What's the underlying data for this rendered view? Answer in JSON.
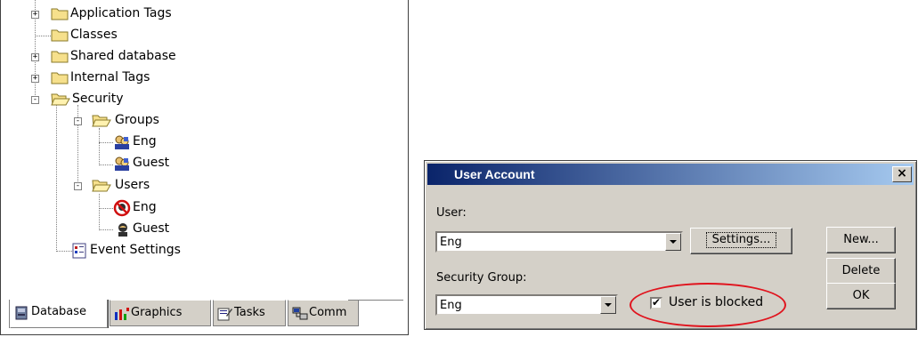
{
  "tree": {
    "nodes": [
      {
        "label": "Application Tags",
        "icon": "folder-icon",
        "expander": "+"
      },
      {
        "label": "Classes",
        "icon": "folder-icon",
        "expander": ""
      },
      {
        "label": "Shared database",
        "icon": "folder-icon",
        "expander": "+"
      },
      {
        "label": "Internal Tags",
        "icon": "folder-icon",
        "expander": "+"
      },
      {
        "label": "Security",
        "icon": "open-folder-icon",
        "expander": "-"
      },
      {
        "label": "Groups",
        "icon": "open-folder-icon",
        "expander": "-"
      },
      {
        "label": "Eng",
        "icon": "group-icon",
        "expander": ""
      },
      {
        "label": "Guest",
        "icon": "group-icon",
        "expander": ""
      },
      {
        "label": "Users",
        "icon": "open-folder-icon",
        "expander": "-"
      },
      {
        "label": "Eng",
        "icon": "blocked-user-icon",
        "expander": ""
      },
      {
        "label": "Guest",
        "icon": "user-icon",
        "expander": ""
      },
      {
        "label": "Event Settings",
        "icon": "event-settings-icon",
        "expander": ""
      }
    ],
    "tabs": [
      {
        "label": "Database",
        "icon": "database-icon",
        "active": true
      },
      {
        "label": "Graphics",
        "icon": "graphics-icon",
        "active": false
      },
      {
        "label": "Tasks",
        "icon": "tasks-icon",
        "active": false
      },
      {
        "label": "Comm",
        "icon": "comm-icon",
        "active": false
      }
    ]
  },
  "dialog": {
    "title": "User Account",
    "close_label": "×",
    "user_label": "User:",
    "user_value": "Eng",
    "settings_label": "Settings...",
    "group_label": "Security Group:",
    "group_value": "Eng",
    "blocked_label": "User is blocked",
    "blocked_checked": true,
    "checkmark": "✔",
    "new_label": "New...",
    "delete_label": "Delete",
    "ok_label": "OK",
    "title_gradient_start": "#0a246a",
    "title_gradient_end": "#a6caf0",
    "highlight_color": "#e0141e"
  }
}
